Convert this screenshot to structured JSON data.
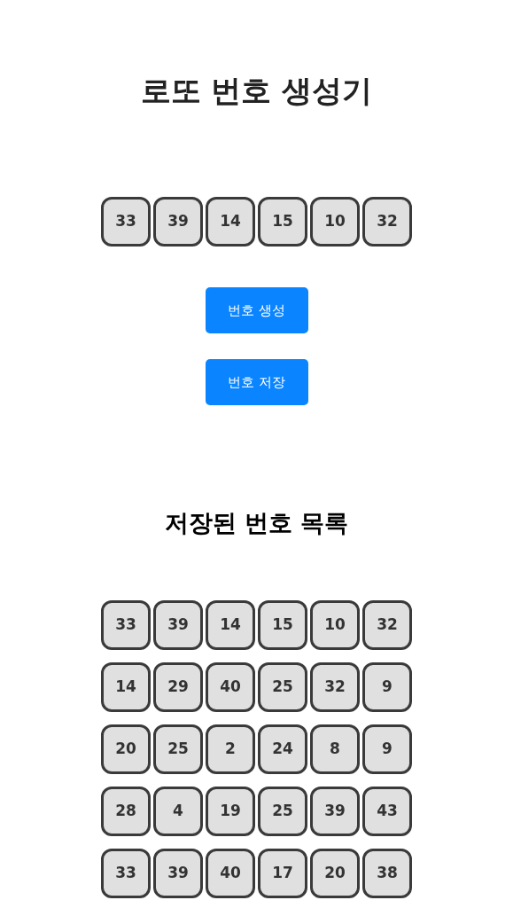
{
  "title": "로또 번호 생성기",
  "current_numbers": [
    "33",
    "39",
    "14",
    "15",
    "10",
    "32"
  ],
  "buttons": [
    {
      "label": "번호 생성"
    },
    {
      "label": "번호 저장"
    }
  ],
  "saved_heading": "저장된 번호 목록",
  "saved_sets": [
    [
      "33",
      "39",
      "14",
      "15",
      "10",
      "32"
    ],
    [
      "14",
      "29",
      "40",
      "25",
      "32",
      "9"
    ],
    [
      "20",
      "25",
      "2",
      "24",
      "8",
      "9"
    ],
    [
      "28",
      "4",
      "19",
      "25",
      "39",
      "43"
    ],
    [
      "33",
      "39",
      "40",
      "17",
      "20",
      "38"
    ]
  ]
}
